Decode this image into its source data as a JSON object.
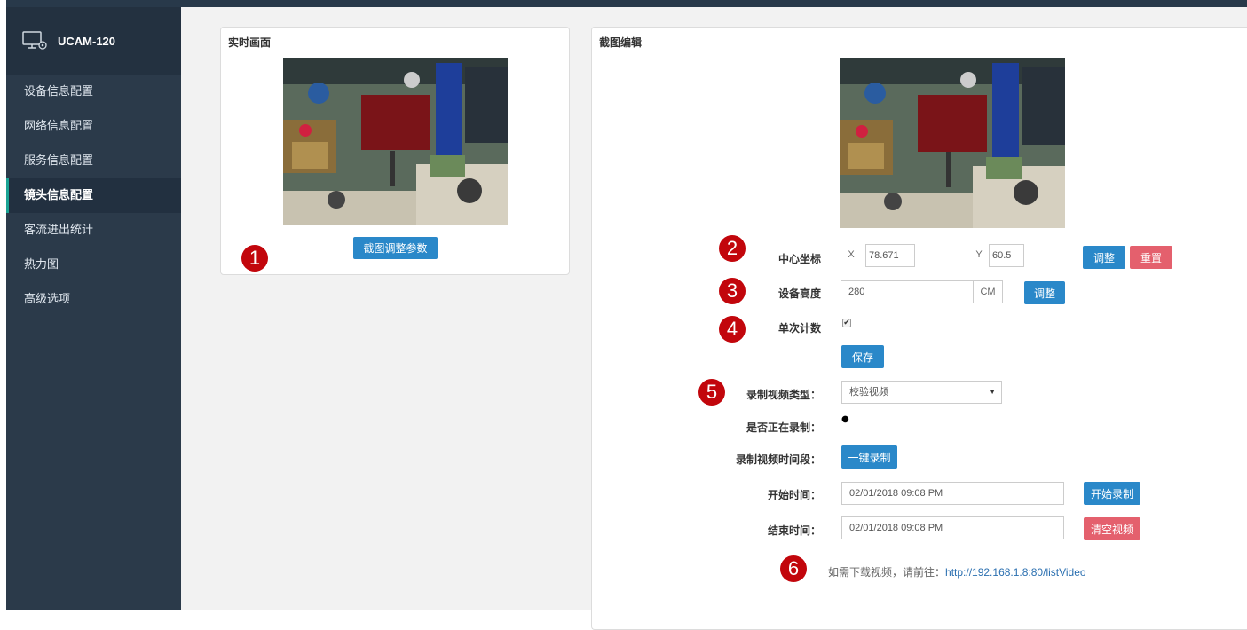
{
  "app": {
    "name": "UCAM-120"
  },
  "sidebar": {
    "items": [
      {
        "label": "设备信息配置"
      },
      {
        "label": "网络信息配置"
      },
      {
        "label": "服务信息配置"
      },
      {
        "label": "镜头信息配置",
        "active": true
      },
      {
        "label": "客流进出统计"
      },
      {
        "label": "热力图"
      },
      {
        "label": "高级选项"
      }
    ]
  },
  "live": {
    "title": "实时画面",
    "capture_button": "截图调整参数"
  },
  "editor": {
    "title": "截图编辑",
    "center": {
      "label": "中心坐标",
      "x_prefix": "X",
      "x_value": "78.671",
      "y_prefix": "Y",
      "y_value": "60.5",
      "adjust_button": "调整",
      "reset_button": "重置"
    },
    "height": {
      "label": "设备高度",
      "value": "280",
      "unit": "CM",
      "adjust_button": "调整"
    },
    "single_count": {
      "label": "单次计数",
      "checked": true
    },
    "save_button": "保存",
    "record_type": {
      "label": "录制视频类型：",
      "selected": "校验视频"
    },
    "recording_status": {
      "label": "是否正在录制：",
      "indicator": "●"
    },
    "record_period": {
      "label": "录制视频时间段：",
      "button": "一键录制"
    },
    "start_time": {
      "label": "开始时间：",
      "value": "02/01/2018 09:08 PM",
      "button": "开始录制"
    },
    "end_time": {
      "label": "结束时间：",
      "value": "02/01/2018 09:08 PM",
      "button": "清空视频"
    },
    "download_note": {
      "text": "如需下载视频，请前往：",
      "link": "http://192.168.1.8:80/listVideo"
    }
  },
  "markers": [
    "1",
    "2",
    "3",
    "4",
    "5",
    "6"
  ],
  "colors": {
    "sidebar": "#2b3a4a",
    "accent": "#1aa394",
    "primary": "#2a88c9",
    "danger": "#e4606d",
    "marker": "#c2060c"
  }
}
